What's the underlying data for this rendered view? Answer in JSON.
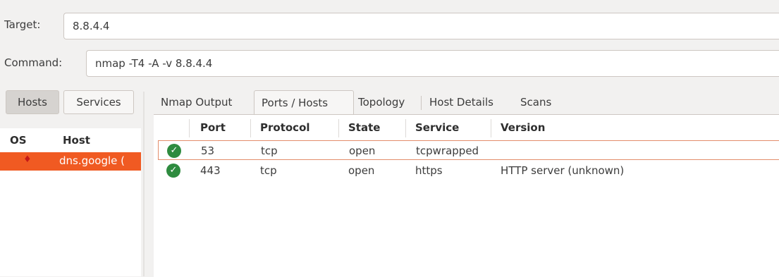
{
  "target": {
    "label": "Target:",
    "value": "8.8.4.4"
  },
  "command": {
    "label": "Command:",
    "value": "nmap -T4 -A -v 8.8.4.4"
  },
  "sidebar": {
    "hosts_button": "Hosts",
    "services_button": "Services",
    "columns": [
      "OS",
      "Host"
    ],
    "hosts": [
      {
        "os_icon": "linux-os-icon",
        "name": "dns.google ("
      }
    ]
  },
  "tabs": [
    "Nmap Output",
    "Ports / Hosts",
    "Topology",
    "Host Details",
    "Scans"
  ],
  "active_tab": "Ports / Hosts",
  "ports_table": {
    "columns": [
      "Port",
      "Protocol",
      "State",
      "Service",
      "Version"
    ],
    "rows": [
      {
        "status_icon": "check-circle-icon",
        "port": "53",
        "protocol": "tcp",
        "state": "open",
        "service": "tcpwrapped",
        "version": ""
      },
      {
        "status_icon": "check-circle-icon",
        "port": "443",
        "protocol": "tcp",
        "state": "open",
        "service": "https",
        "version": "HTTP server (unknown)"
      }
    ]
  },
  "colors": {
    "selection": "#f05a22",
    "open_status": "#2e8b3f"
  }
}
